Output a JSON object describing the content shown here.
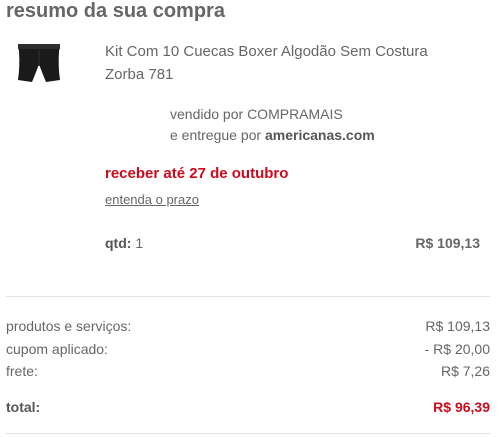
{
  "summary": {
    "title": "resumo da sua compra",
    "product": {
      "name": "Kit Com 10 Cuecas Boxer Algodão Sem Costura Zorba 781",
      "sold_by_prefix": "vendido por ",
      "seller": "COMPRAMAIS",
      "delivered_by_prefix": "e entregue por ",
      "deliverer": "americanas.com",
      "delivery_estimate": "receber até 27 de outubro",
      "delivery_link": "entenda o prazo",
      "qty_label": "qtd:",
      "qty_value": "1",
      "price": "R$ 109,13",
      "thumbnail_icon": "boxer-briefs-icon"
    },
    "totals": {
      "products_label": "produtos e serviços:",
      "products_value": "R$ 109,13",
      "coupon_label": "cupom aplicado:",
      "coupon_value": "- R$ 20,00",
      "shipping_label": "frete:",
      "shipping_value": "R$ 7,26",
      "total_label": "total:",
      "total_value": "R$ 96,39"
    },
    "colors": {
      "accent_red": "#cc0a1c",
      "text_gray": "#666666"
    }
  }
}
